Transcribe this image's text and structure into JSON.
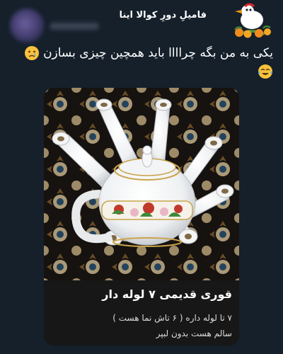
{
  "tweet": {
    "author_name": "فامیلِ دورِ کوالا اینا",
    "text": "یکی به من بگه چراااا باید همچین چیزی بسازن",
    "emojis": [
      "crying-face",
      "tears-of-joy"
    ]
  },
  "media": {
    "image_description": "teapot-with-seven-spouts",
    "caption_title": "قوری قدیمی ۷ لوله دار",
    "caption_line1": "۷ تا لوله داره ( ۶ تاش نما هست )",
    "caption_line2": "سالم هست بدون لبپر"
  },
  "colors": {
    "background": "#15202b",
    "caption_bg": "#171717",
    "text": "#ffffff"
  }
}
